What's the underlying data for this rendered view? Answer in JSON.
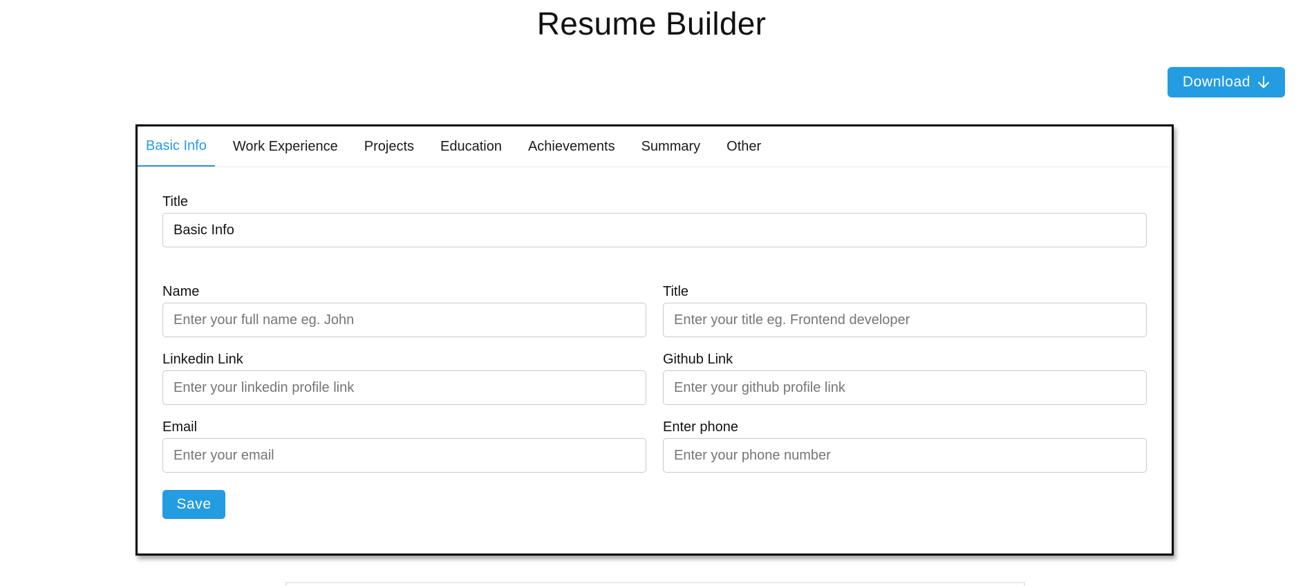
{
  "app": {
    "title": "Resume Builder"
  },
  "header": {
    "download_label": "Download",
    "download_icon": "arrow-down-icon"
  },
  "tabs": [
    {
      "label": "Basic Info",
      "active": true
    },
    {
      "label": "Work Experience",
      "active": false
    },
    {
      "label": "Projects",
      "active": false
    },
    {
      "label": "Education",
      "active": false
    },
    {
      "label": "Achievements",
      "active": false
    },
    {
      "label": "Summary",
      "active": false
    },
    {
      "label": "Other",
      "active": false
    }
  ],
  "form": {
    "section_title": {
      "label": "Title",
      "value": "Basic Info"
    },
    "name": {
      "label": "Name",
      "placeholder": "Enter your full name eg. John"
    },
    "title": {
      "label": "Title",
      "placeholder": "Enter your title eg. Frontend developer"
    },
    "linkedin": {
      "label": "Linkedin Link",
      "placeholder": "Enter your linkedin profile link"
    },
    "github": {
      "label": "Github Link",
      "placeholder": "Enter your github profile link"
    },
    "email": {
      "label": "Email",
      "placeholder": "Enter your email"
    },
    "phone": {
      "label": "Enter phone",
      "placeholder": "Enter your phone number"
    },
    "save_label": "Save"
  },
  "colors": {
    "accent": "#239ce2",
    "card_border": "#000000",
    "input_border": "#c9c9c9"
  }
}
